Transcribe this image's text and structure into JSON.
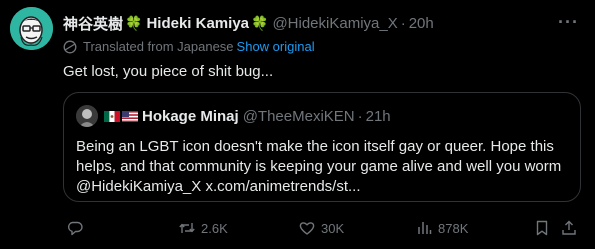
{
  "author": {
    "display_name": "神谷英樹",
    "display_name_en": "Hideki Kamiya",
    "clover": "🍀",
    "handle": "@HidekiKamiya_X",
    "dot": "·",
    "time": "20h"
  },
  "translation": {
    "label": "Translated from Japanese",
    "show_original": "Show original"
  },
  "tweet_text": "Get lost, you piece of shit bug...",
  "quote": {
    "name": "Hokage Minaj",
    "handle": "@TheeMexiKEN",
    "dot": "·",
    "time": "21h",
    "lines": [
      "Being an LGBT icon doesn't make the icon itself gay or queer. Hope this",
      "helps, and that community is keeping your game alive and well you worm",
      "@HidekiKamiya_X x.com/animetrends/st..."
    ]
  },
  "actions": {
    "reply_count": "",
    "retweet_count": "2.6K",
    "like_count": "30K",
    "view_count": "878K"
  },
  "colors": {
    "background": "#000000",
    "text": "#e7e9ea",
    "muted": "#71767b",
    "link": "#1d9bf0",
    "border": "#2f3336"
  },
  "icons": [
    "globe-icon",
    "more-icon",
    "reply-icon",
    "retweet-icon",
    "like-icon",
    "views-icon",
    "bookmark-icon",
    "share-icon",
    "mexico-flag-icon",
    "usa-flag-icon",
    "clover-icon"
  ]
}
